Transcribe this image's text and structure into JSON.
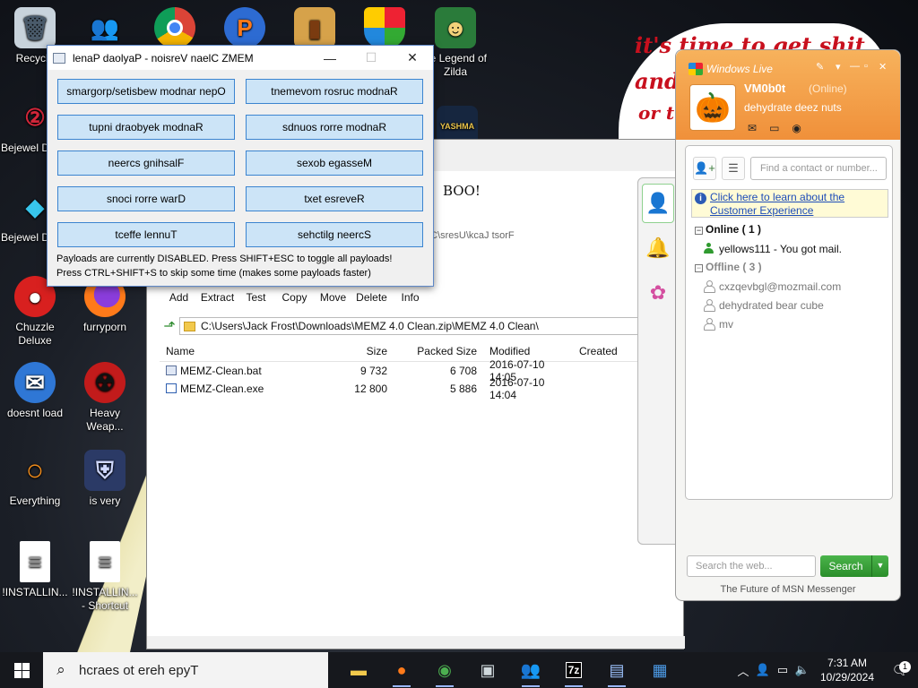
{
  "desktop": {
    "icons": [
      {
        "label": "Recycle"
      },
      {
        "label": "Bejewel Delux"
      },
      {
        "label": "Bejewel Delux"
      },
      {
        "label": "Chuzzle Deluxe"
      },
      {
        "label": "doesnt load"
      },
      {
        "label": "Everything"
      },
      {
        "label": "!INSTALLIN..."
      },
      {
        "label": "furryporn"
      },
      {
        "label": "Heavy Weap..."
      },
      {
        "label": "is very"
      },
      {
        "label": "!INSTALLIN... - Shortcut"
      },
      {
        "label": "he Legend of Zilda"
      },
      {
        "label": "YASHMA"
      }
    ],
    "speech_lines": [
      "it's time to get shit",
      "and",
      "or t"
    ]
  },
  "memz": {
    "title": "lenaP daolyaP - noisreV naelC ZMEM",
    "buttons": [
      "smargorp/setisbew modnar nepO",
      "tnemevom rosruc modnaR",
      "tupni draobyek modnaR",
      "sdnuos rorre modnaR",
      "neercs gnihsalF",
      "sexob egasseM",
      "snoci rorre warD",
      "txet esreveR",
      "tceffe lennuT",
      "sehctilg neercS"
    ],
    "note1": "Payloads are currently DISABLED. Press SHIFT+ESC to toggle all payloads!",
    "note2": "Press CTRL+SHIFT+S to skip some time (makes some payloads faster)"
  },
  "sevenzip": {
    "boo_text": "BOO!",
    "faded_path": "\\:C\\sresU\\kcaJ tsorF",
    "toolbar": [
      "Add",
      "Extract",
      "Test",
      "Copy",
      "Move",
      "Delete",
      "Info"
    ],
    "path": "C:\\Users\\Jack Frost\\Downloads\\MEMZ 4.0 Clean.zip\\MEMZ 4.0 Clean\\",
    "columns": [
      "Name",
      "Size",
      "Packed Size",
      "Modified",
      "Created"
    ],
    "files": [
      {
        "name": "MEMZ-Clean.bat",
        "size": "9 732",
        "packed": "6 708",
        "modified": "2016-07-10 14:05",
        "created": ""
      },
      {
        "name": "MEMZ-Clean.exe",
        "size": "12 800",
        "packed": "5 886",
        "modified": "2016-07-10 14:04",
        "created": ""
      }
    ]
  },
  "messenger": {
    "brand": "Windows Live",
    "username": "VM0b0t",
    "status": "(Online)",
    "personal_message": "dehydrate deez nuts",
    "find_placeholder": "Find a contact or number...",
    "banner_line1": "Click here to learn about the",
    "banner_line2": "Customer Experience",
    "online_group": "Online ( 1 )",
    "online_contacts": [
      "yellows111 - You got mail."
    ],
    "offline_group": "Offline ( 3 )",
    "offline_contacts": [
      "cxzqevbgl@mozmail.com",
      "dehydrated bear cube",
      "mv"
    ],
    "search_placeholder": "Search the web...",
    "search_button": "Search",
    "footer": "The Future of MSN Messenger"
  },
  "taskbar": {
    "search_text": "hcraes ot ereh epyT",
    "time": "7:31 AM",
    "date": "10/29/2024",
    "notification_count": "1"
  },
  "colors": {
    "messenger_orange": "#f0903a",
    "memz_button": "#cce4f7",
    "search_green": "#2a8e2a",
    "taskbar": "#16181d"
  }
}
